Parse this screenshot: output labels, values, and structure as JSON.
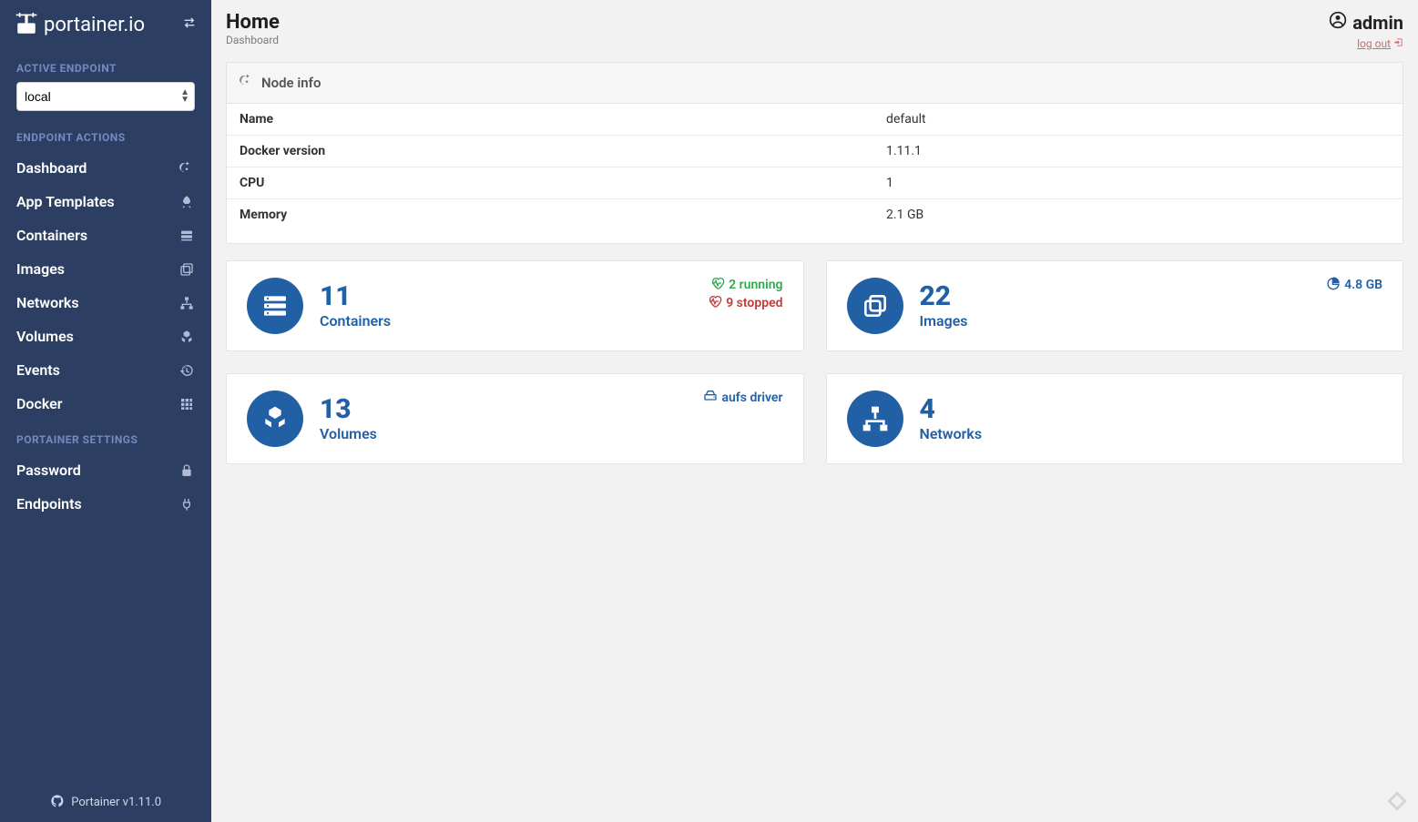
{
  "brand": {
    "name": "portainer.io"
  },
  "sidebar": {
    "toggle_icon": "collapse-icon",
    "section_endpoint_label": "ACTIVE ENDPOINT",
    "endpoint_selected": "local",
    "section_actions_label": "ENDPOINT ACTIONS",
    "actions": [
      {
        "label": "Dashboard",
        "icon": "dashboard-icon"
      },
      {
        "label": "App Templates",
        "icon": "rocket-icon"
      },
      {
        "label": "Containers",
        "icon": "server-icon"
      },
      {
        "label": "Images",
        "icon": "clone-icon"
      },
      {
        "label": "Networks",
        "icon": "sitemap-icon"
      },
      {
        "label": "Volumes",
        "icon": "cubes-icon"
      },
      {
        "label": "Events",
        "icon": "history-icon"
      },
      {
        "label": "Docker",
        "icon": "th-icon"
      }
    ],
    "section_settings_label": "PORTAINER SETTINGS",
    "settings": [
      {
        "label": "Password",
        "icon": "lock-icon"
      },
      {
        "label": "Endpoints",
        "icon": "plug-icon"
      }
    ],
    "footer": "Portainer v1.11.0"
  },
  "header": {
    "title": "Home",
    "subtitle": "Dashboard",
    "user": "admin",
    "logout_label": "log out"
  },
  "node_info": {
    "panel_title": "Node info",
    "rows": [
      {
        "key": "Name",
        "value": "default"
      },
      {
        "key": "Docker version",
        "value": "1.11.1"
      },
      {
        "key": "CPU",
        "value": "1"
      },
      {
        "key": "Memory",
        "value": "2.1 GB"
      }
    ]
  },
  "stats": {
    "containers": {
      "count": "11",
      "label": "Containers",
      "running": "2 running",
      "stopped": "9 stopped"
    },
    "images": {
      "count": "22",
      "label": "Images",
      "size": "4.8 GB"
    },
    "volumes": {
      "count": "13",
      "label": "Volumes",
      "driver": "aufs driver"
    },
    "networks": {
      "count": "4",
      "label": "Networks"
    }
  }
}
